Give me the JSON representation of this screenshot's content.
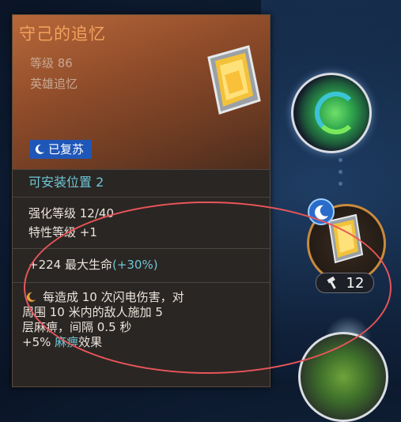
{
  "tooltip": {
    "title": "守己的追忆",
    "level": "等级 86",
    "rarity": "英雄追忆",
    "revived_label": "已复苏",
    "install_slots": "可安装位置  2",
    "enhance_level": "强化等级  12/40",
    "trait_level": "特性等级  +1",
    "hp_bonus_base": "+224 最大生命",
    "hp_bonus_pct": "(+30%)",
    "effect": {
      "line1": "每造成 10 次闪电伤害，对",
      "line2": "周围 10 米内的敌人施加 5",
      "line3": "层麻痹，间隔 0.5 秒",
      "line4_prefix": "+5% ",
      "line4_keyword": "麻痹",
      "line4_suffix": "效果"
    }
  },
  "nodes": {
    "equipped_level": "12"
  },
  "colors": {
    "title": "#f2a15c",
    "accent_cyan": "#6fc6d6",
    "badge_blue": "#1f57b8",
    "annotation_red": "#e8555a"
  },
  "icons": [
    "moon-icon",
    "hammer-icon",
    "gem-icon",
    "nature-orb-icon"
  ]
}
